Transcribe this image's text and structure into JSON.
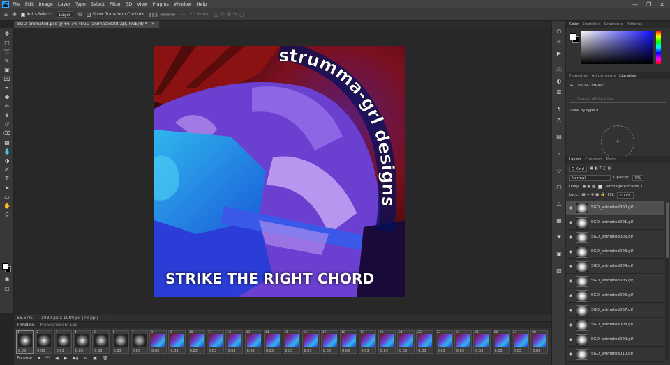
{
  "menubar": {
    "app_logo": "Ps",
    "items": [
      "File",
      "Edit",
      "Image",
      "Layer",
      "Type",
      "Select",
      "Filter",
      "3D",
      "View",
      "Plugins",
      "Window",
      "Help"
    ]
  },
  "options_bar": {
    "auto_select_label": "Auto-Select:",
    "auto_select_target": "Layer",
    "show_transform_label": "Show Transform Controls",
    "mode_3d_label": "3D Mode:"
  },
  "document_tab": {
    "title": "SGD_animated.psd @ 66.7% (SGD_animated000.gif, RGB/8) *",
    "close": "×"
  },
  "artwork": {
    "arc_text": "strumma-grl designs",
    "bottom_text": "STRIKE THE RIGHT CHORD",
    "colors": {
      "red": "#8a1212",
      "violet": "#6b3fd0",
      "lavender": "#b796f0",
      "cyan": "#2fb6ee",
      "blue": "#2a3dd6"
    }
  },
  "status_bar": {
    "zoom": "66.67%",
    "doc_size": "1080 px x 1080 px (72 ppi)"
  },
  "timeline": {
    "tabs": [
      "Timeline",
      "Measurement Log"
    ],
    "loop": "Forever",
    "frames": [
      {
        "n": "1",
        "delay": "0.03"
      },
      {
        "n": "2",
        "delay": "0.03"
      },
      {
        "n": "3",
        "delay": "0.03"
      },
      {
        "n": "4",
        "delay": "0.03"
      },
      {
        "n": "5",
        "delay": "0.03"
      },
      {
        "n": "6",
        "delay": "0.03"
      },
      {
        "n": "7",
        "delay": "0.03"
      },
      {
        "n": "8",
        "delay": "0.03"
      },
      {
        "n": "9",
        "delay": "0.03"
      },
      {
        "n": "10",
        "delay": "0.03"
      },
      {
        "n": "11",
        "delay": "0.03"
      },
      {
        "n": "12",
        "delay": "0.03"
      },
      {
        "n": "13",
        "delay": "0.03"
      },
      {
        "n": "14",
        "delay": "0.03"
      },
      {
        "n": "15",
        "delay": "0.03"
      },
      {
        "n": "16",
        "delay": "0.03"
      },
      {
        "n": "17",
        "delay": "0.03"
      },
      {
        "n": "18",
        "delay": "0.03"
      },
      {
        "n": "19",
        "delay": "0.03"
      },
      {
        "n": "20",
        "delay": "0.03"
      },
      {
        "n": "21",
        "delay": "0.03"
      },
      {
        "n": "22",
        "delay": "0.03"
      },
      {
        "n": "23",
        "delay": "0.03"
      },
      {
        "n": "24",
        "delay": "0.03"
      },
      {
        "n": "25",
        "delay": "0.03"
      },
      {
        "n": "26",
        "delay": "0.03"
      },
      {
        "n": "27",
        "delay": "0.03"
      },
      {
        "n": "28",
        "delay": "0.03"
      }
    ]
  },
  "color_panel": {
    "tabs": [
      "Color",
      "Swatches",
      "Gradients",
      "Patterns"
    ]
  },
  "libraries_panel": {
    "tabs": [
      "Properties",
      "Adjustments",
      "Libraries"
    ],
    "library_name": "YOUR LIBRARY",
    "search_placeholder": "Search all libraries",
    "view_by": "View by type"
  },
  "layers_panel": {
    "tabs": [
      "Layers",
      "Channels",
      "Paths"
    ],
    "filter_kind": "Kind",
    "blend_mode": "Normal",
    "opacity_label": "Opacity:",
    "opacity_value": "0%",
    "unify_label": "Unify:",
    "propagate_label": "Propagate Frame 1",
    "lock_label": "Lock:",
    "fill_label": "Fill:",
    "fill_value": "100%",
    "layers": [
      "SGD_animated000.gif",
      "SGD_animated001.gif",
      "SGD_animated002.gif",
      "SGD_animated003.gif",
      "SGD_animated004.gif",
      "SGD_animated005.gif",
      "SGD_animated006.gif",
      "SGD_animated007.gif",
      "SGD_animated008.gif",
      "SGD_animated009.gif",
      "SGD_animated010.gif"
    ]
  }
}
